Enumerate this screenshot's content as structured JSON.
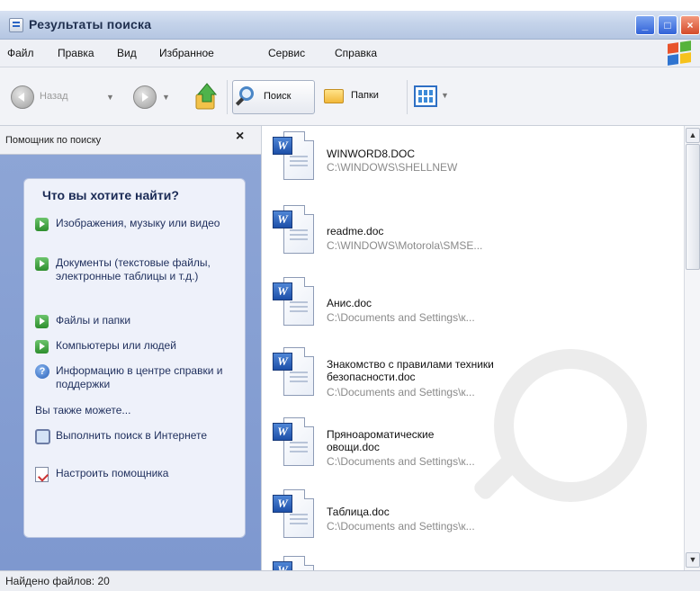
{
  "window": {
    "title": "Результаты поиска",
    "controls": [
      "minimize",
      "maximize",
      "close"
    ]
  },
  "menubar": {
    "items": [
      "Файл",
      "Правка",
      "Вид",
      "Избранное",
      "Сервис",
      "Справка"
    ]
  },
  "toolbar": {
    "back_label": "Назад",
    "search_label": "Поиск",
    "folders_label": "Папки",
    "icons": [
      "back-icon",
      "forward-icon",
      "up-folder-icon",
      "search-icon",
      "folders-icon",
      "views-icon"
    ]
  },
  "search_pane": {
    "header": "Помощник по поиску",
    "question": "Что вы хотите найти?",
    "options": [
      {
        "label": "Изображения, музыку или видео",
        "icon": "green-arrow-icon"
      },
      {
        "label": "Документы (текстовые файлы, электронные таблицы и т.д.)",
        "icon": "green-arrow-icon"
      },
      {
        "label": "Файлы и папки",
        "icon": "green-arrow-icon"
      },
      {
        "label": "Компьютеры или людей",
        "icon": "green-arrow-icon"
      },
      {
        "label": "Информацию в центре справки и поддержки",
        "icon": "help-icon"
      }
    ],
    "also_label": "Вы также можете...",
    "also_options": [
      {
        "label": "Выполнить поиск в Интернете",
        "icon": "internet-search-icon"
      },
      {
        "label": "Настроить помощника",
        "icon": "settings-note-icon"
      }
    ]
  },
  "results": [
    {
      "name": "WINWORD8.DOC",
      "path": "C:\\WINDOWS\\SHELLNEW"
    },
    {
      "name": "readme.doc",
      "path": "C:\\WINDOWS\\Motorola\\SMSE..."
    },
    {
      "name": "Анис.doc",
      "path": "C:\\Documents and Settings\\к..."
    },
    {
      "name": "Знакомство с правилами техники безопасности.doc",
      "path": "C:\\Documents and Settings\\к..."
    },
    {
      "name": "Пряноароматические овощи.doc",
      "path": "C:\\Documents and Settings\\к..."
    },
    {
      "name": "Таблица.doc",
      "path": "C:\\Documents and Settings\\к..."
    }
  ],
  "status": {
    "text": "Найдено файлов: 20"
  },
  "colors": {
    "task_pane": "#7e98cf",
    "word_icon": "#1d4fa8",
    "path_text": "#8a8a8a"
  }
}
